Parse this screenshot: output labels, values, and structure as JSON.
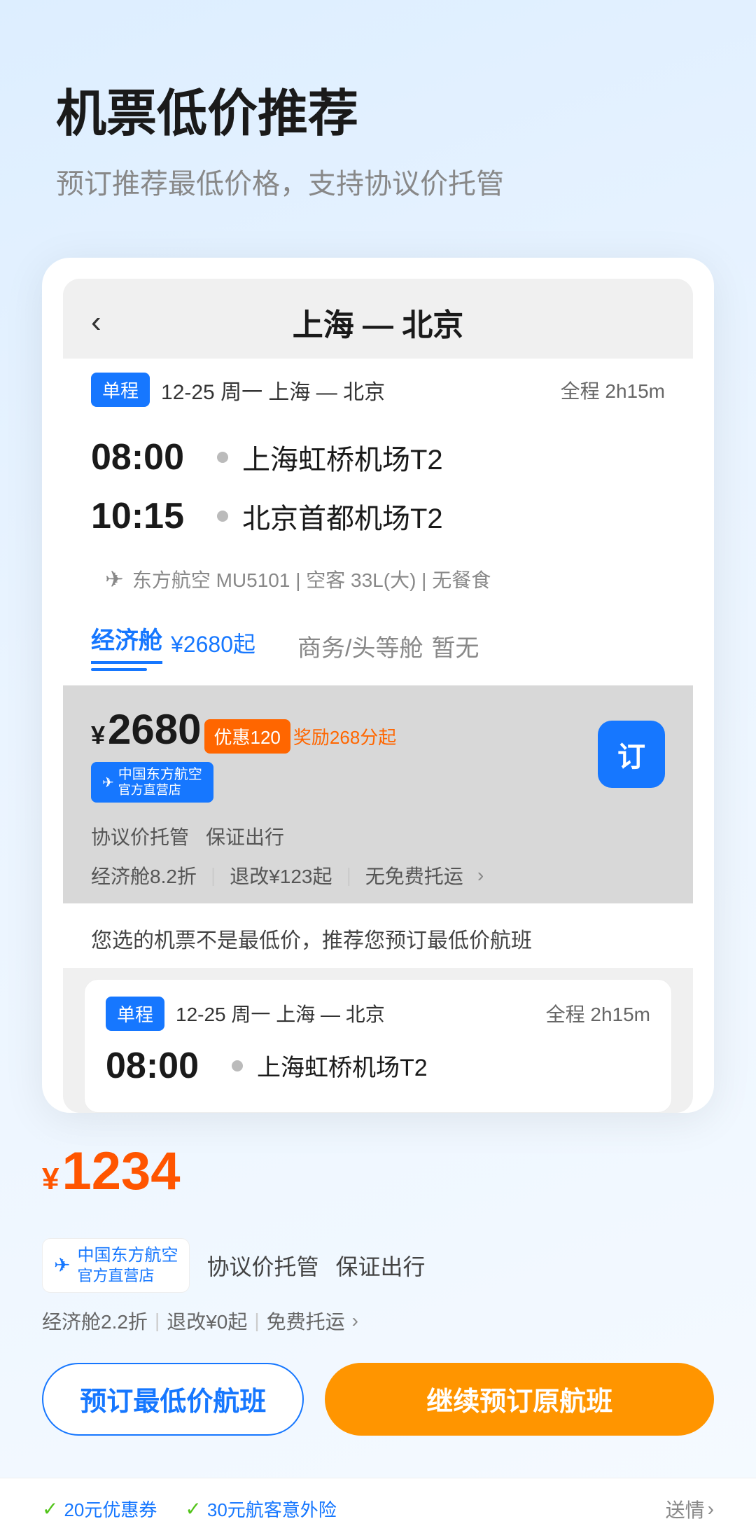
{
  "header": {
    "main_title": "机票低价推荐",
    "sub_title": "预订推荐最低价格，支持协议价托管"
  },
  "inner_card": {
    "back_label": "‹",
    "route": "上海 — 北京",
    "badge_one_way": "单程",
    "flight_meta": "12-25  周一  上海 — 北京",
    "duration": "全程 2h15m",
    "departure_time": "08:00",
    "departure_airport": "上海虹桥机场T2",
    "arrival_time": "10:15",
    "arrival_airport": "北京首都机场T2",
    "airline_info": "东方航空 MU5101 | 空客 33L(大) | 无餐食",
    "cabin_economy": "经济舱",
    "cabin_economy_price": "¥2680起",
    "cabin_business": "商务/头等舱",
    "cabin_business_status": "暂无",
    "price_main": "2680",
    "price_yen": "¥",
    "discount_badge": "优惠120",
    "reward_text": "奖励268分起",
    "airline_badge_line1": "中国东方航空",
    "airline_badge_line2": "官方直营店",
    "book_btn": "订",
    "price_sub1": "协议价托管",
    "price_sub2": "保证出行",
    "price_detail1": "经济舱8.2折",
    "price_detail2": "退改¥123起",
    "price_detail3": "无免费托运",
    "rec_notice": "您选的机票不是最低价，推荐您预订最低价航班",
    "lower_badge": "单程",
    "lower_meta": "12-25  周一  上海 — 北京",
    "lower_duration": "全程 2h15m",
    "lower_time": "08:00",
    "lower_airport": "上海虹桥机场T2"
  },
  "bottom": {
    "price": "1234",
    "price_yen": "¥",
    "airline_logo_text": "中国东方航空",
    "airline_logo_sub": "官方直营店",
    "tag1": "协议价托管",
    "tag2": "保证出行",
    "detail1": "经济舱2.2折",
    "detail2": "退改¥0起",
    "detail3": "免费托运",
    "btn_low_price": "预订最低价航班",
    "btn_original": "继续预订原航班",
    "footer_coupon": "20元优惠券",
    "footer_insurance": "30元航客意外险",
    "footer_more": "送情"
  }
}
